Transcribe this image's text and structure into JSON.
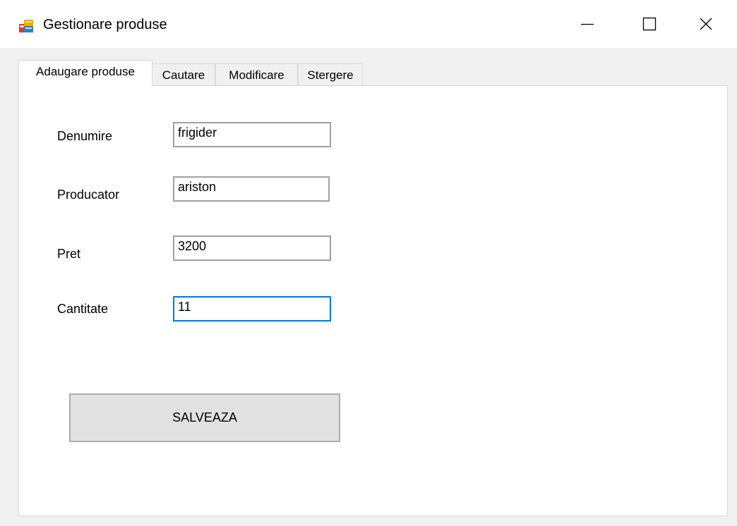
{
  "window": {
    "title": "Gestionare produse",
    "icon": "winforms-app-icon",
    "controls": {
      "minimize": "minimize-icon",
      "maximize": "maximize-icon",
      "close": "close-icon"
    }
  },
  "tabs": [
    {
      "label": "Adaugare produse",
      "active": true
    },
    {
      "label": "Cautare",
      "active": false
    },
    {
      "label": "Modificare",
      "active": false
    },
    {
      "label": "Stergere",
      "active": false
    }
  ],
  "form": {
    "fields": [
      {
        "label": "Denumire",
        "value": "frigider"
      },
      {
        "label": "Producator",
        "value": "ariston"
      },
      {
        "label": "Pret",
        "value": "3200"
      },
      {
        "label": "Cantitate",
        "value": "11",
        "focused": true
      }
    ],
    "save_label": "SALVEAZA"
  },
  "colors": {
    "window_bg": "#f0f0f0",
    "panel_bg": "#ffffff",
    "focus_border": "#0078d7",
    "button_bg": "#e1e1e1"
  }
}
